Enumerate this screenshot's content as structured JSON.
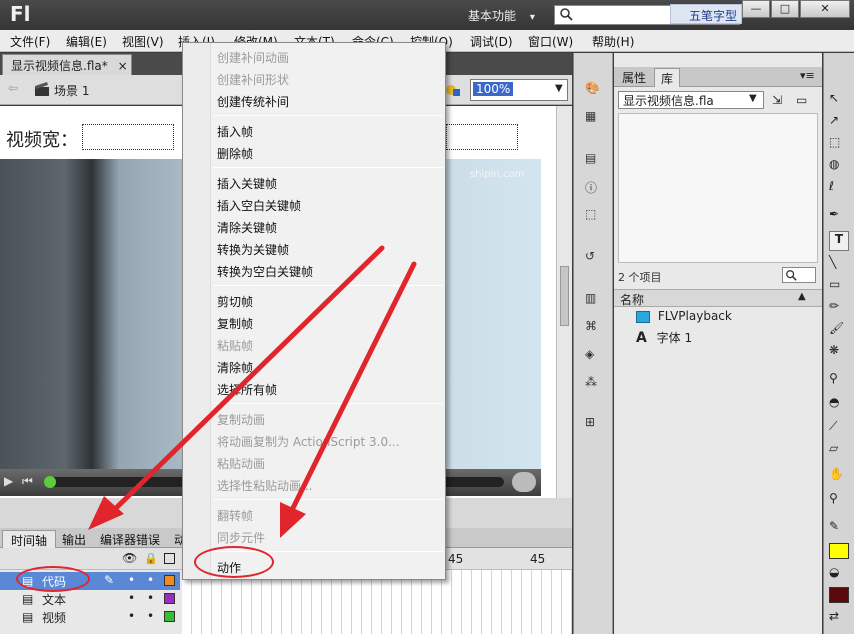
{
  "app": {
    "logo": "Fl",
    "workspace": "基本功能",
    "workspace_caret": "▾",
    "watermark": "五笔字型",
    "window_buttons": [
      "—",
      "□",
      "✕"
    ]
  },
  "menubar": {
    "items": [
      "文件(F)",
      "编辑(E)",
      "视图(V)",
      "插入(I)",
      "修改(M)",
      "文本(T)",
      "命令(C)",
      "控制(O)",
      "调试(D)",
      "窗口(W)",
      "帮助(H)"
    ]
  },
  "document": {
    "tab_label": "显示视频信息.fla*",
    "tab_close": "×",
    "scene_label": "场景 1",
    "zoom": "100%",
    "stage_label": "视频宽：",
    "video_watermark": "shipin.com"
  },
  "timeline": {
    "tabs": [
      "时间轴",
      "输出",
      "编译器错误",
      "动"
    ],
    "frame_numbers": [
      "45"
    ],
    "layers": [
      {
        "name": "代码",
        "color": "#f08c1e",
        "selected": true
      },
      {
        "name": "文本",
        "color": "#9b2cc4",
        "selected": false
      },
      {
        "name": "视频",
        "color": "#35c033",
        "selected": false
      }
    ]
  },
  "context_menu": {
    "groups": [
      [
        {
          "label": "创建补间动画",
          "enabled": false
        },
        {
          "label": "创建补间形状",
          "enabled": false
        },
        {
          "label": "创建传统补间",
          "enabled": true
        }
      ],
      [
        {
          "label": "插入帧",
          "enabled": true
        },
        {
          "label": "删除帧",
          "enabled": true
        }
      ],
      [
        {
          "label": "插入关键帧",
          "enabled": true
        },
        {
          "label": "插入空白关键帧",
          "enabled": true
        },
        {
          "label": "清除关键帧",
          "enabled": true
        },
        {
          "label": "转换为关键帧",
          "enabled": true
        },
        {
          "label": "转换为空白关键帧",
          "enabled": true
        }
      ],
      [
        {
          "label": "剪切帧",
          "enabled": true
        },
        {
          "label": "复制帧",
          "enabled": true
        },
        {
          "label": "粘贴帧",
          "enabled": false
        },
        {
          "label": "清除帧",
          "enabled": true
        },
        {
          "label": "选择所有帧",
          "enabled": true
        }
      ],
      [
        {
          "label": "复制动画",
          "enabled": false
        },
        {
          "label": "将动画复制为 ActionScript 3.0...",
          "enabled": false
        },
        {
          "label": "粘贴动画",
          "enabled": false
        },
        {
          "label": "选择性粘贴动画...",
          "enabled": false
        }
      ],
      [
        {
          "label": "翻转帧",
          "enabled": false
        },
        {
          "label": "同步元件",
          "enabled": false
        }
      ],
      [
        {
          "label": "动作",
          "enabled": true
        }
      ]
    ]
  },
  "library": {
    "tabs": [
      "属性",
      "库"
    ],
    "active_tab": "库",
    "file": "显示视频信息.fla",
    "count": "2 个项目",
    "column_header": "名称",
    "items": [
      {
        "name": "FLVPlayback",
        "icon": "component-icon"
      },
      {
        "name": "字体 1",
        "icon": "font-icon"
      }
    ]
  },
  "colors": {
    "annotation": "#e0262c",
    "selection": "#3a68c8",
    "fill_color": "#ffff00",
    "stroke_color": "#5a0a0a"
  }
}
